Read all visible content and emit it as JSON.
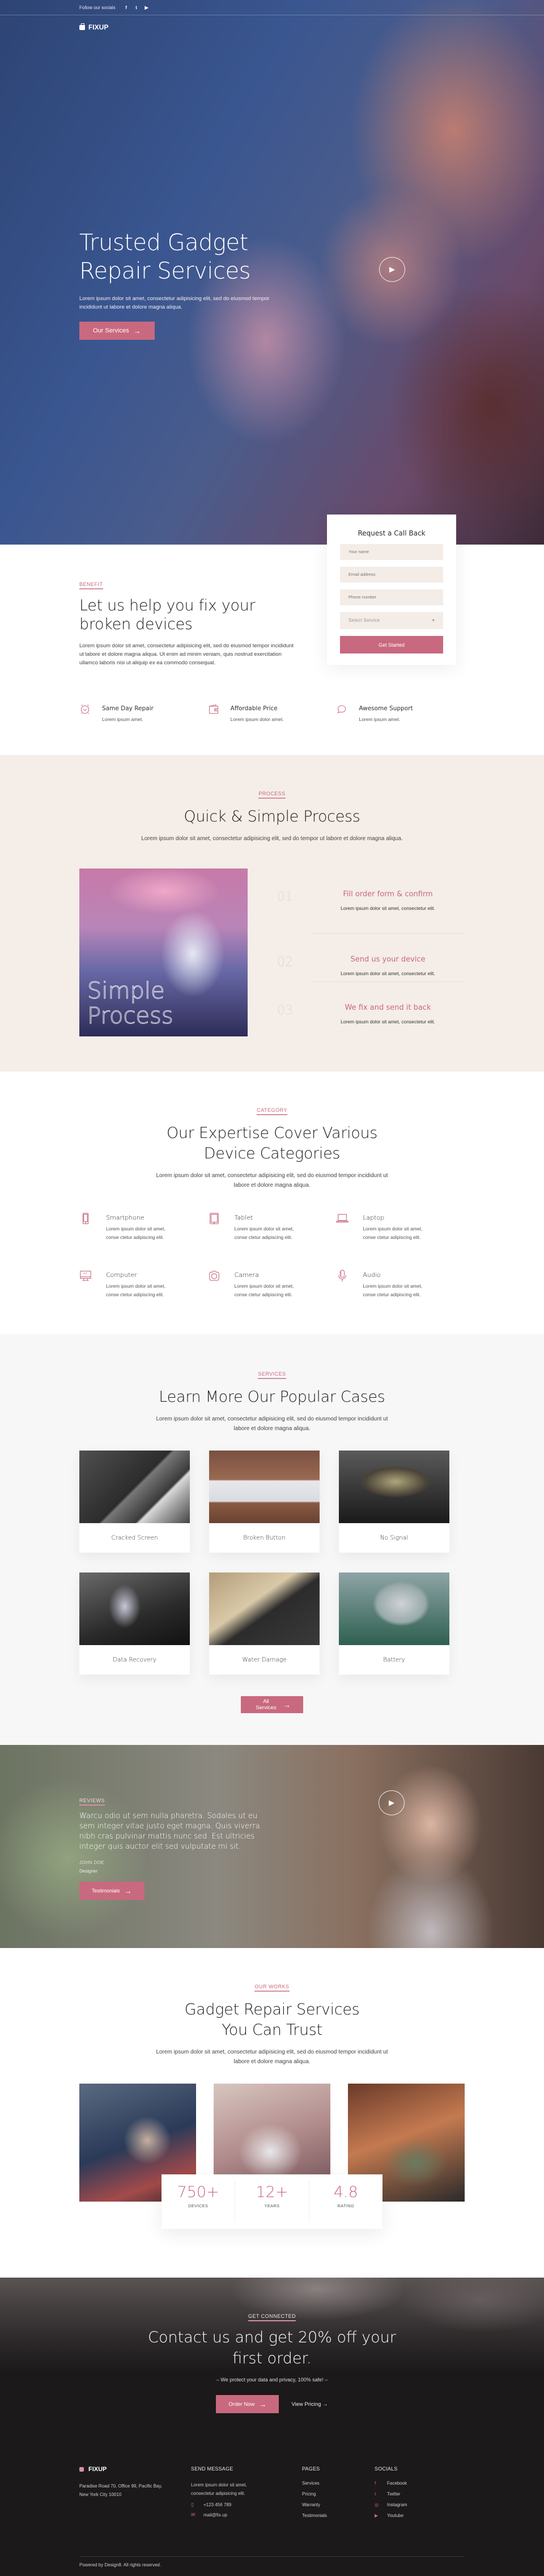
{
  "topbar": {
    "follow_label": "Follow our socials",
    "social_icons": [
      "facebook-icon",
      "twitter-icon",
      "youtube-icon"
    ]
  },
  "brand": {
    "name": "FIXUP",
    "accent_color": "#c9697f"
  },
  "hero": {
    "title": "Trusted Gadget Repair Services",
    "description": "Lorem ipsum dolor sit amet, consectetur adipisicing elit, sed do eiusmod tempor incididunt ut labore et dolore magna aliqua.",
    "button": "Our Services",
    "play_icon": "play-icon"
  },
  "callback": {
    "title": "Request a Call Back",
    "name_placeholder": "Your name",
    "email_placeholder": "Email address",
    "phone_placeholder": "Phone number",
    "service_selected": "Select Service",
    "submit": "Get Started"
  },
  "benefit": {
    "tag": "BENEFIT",
    "title": "Let us help you fix your broken devices",
    "text": "Lorem ipsum dolor sit amet, consectetur adipisicing elit, sed do eiusmod tempor incididunt ut labore et dolore magna aliqua. Ut enim ad minim veniam, quis nostrud exercitation ullamco laboris nisi ut aliquip ex ea commodo consequat.",
    "features": [
      {
        "icon": "alarm-clock-icon",
        "title": "Same Day Repair",
        "text": "Lorem ipsum amet."
      },
      {
        "icon": "wallet-icon",
        "title": "Affordable Price",
        "text": "Lorem ipsum dolor amet."
      },
      {
        "icon": "chat-bubble-icon",
        "title": "Awesome Support",
        "text": "Lorem ipsum amet."
      }
    ]
  },
  "process": {
    "tag": "PROCESS",
    "title": "Quick & Simple Process",
    "subtitle": "Lorem ipsum dolor sit amet, consectetur adipisicing elit, sed do  tempor  ut labore et dolore magna aliqua.",
    "image_label": "Simple Process",
    "steps": [
      {
        "num": "01",
        "title": "Fill order form & confirm",
        "text": "Lorem ipsum dolor sit amet, consectetur elit."
      },
      {
        "num": "02",
        "title": "Send us your device",
        "text": "Lorem ipsum dolor sit amet, consectetur elit."
      },
      {
        "num": "03",
        "title": "We fix and send it back",
        "text": "Lorem ipsum dolor sit amet, consectetur elit."
      }
    ]
  },
  "categories": {
    "tag": "CATEGORY",
    "title": "Our Expertise Cover Various Device Categories",
    "subtitle": "Lorem ipsum dolor sit amet, consectetur adipisicing elit, sed do eiusmod tempor incididunt ut labore et dolore magna aliqua.",
    "items": [
      {
        "icon": "smartphone-icon",
        "title": "Smartphone",
        "text": "Lorem ipsum dolor sit amet, conse ctetur adipiscing elit."
      },
      {
        "icon": "tablet-icon",
        "title": "Tablet",
        "text": "Lorem ipsum dolor sit amet, conse ctetur adipiscing elit."
      },
      {
        "icon": "laptop-icon",
        "title": "Laptop",
        "text": "Lorem ipsum dolor sit amet, conse ctetur adipiscing elit."
      },
      {
        "icon": "computer-icon",
        "title": "Computer",
        "text": "Lorem ipsum dolor sit amet, conse ctetur adipiscing elit."
      },
      {
        "icon": "camera-icon",
        "title": "Camera",
        "text": "Lorem ipsum dolor sit amet, conse ctetur adipiscing elit."
      },
      {
        "icon": "microphone-icon",
        "title": "Audio",
        "text": "Lorem ipsum dolor sit amet, conse ctetur adipiscing elit."
      }
    ]
  },
  "cases": {
    "tag": "SERVICES",
    "title": "Learn More Our Popular Cases",
    "subtitle": "Lorem ipsum dolor sit amet, consectetur adipisicing elit, sed do eiusmod tempor incididunt ut labore et dolore magna aliqua.",
    "items": [
      "Cracked Screen",
      "Broken Button",
      "No Signal",
      "Data Recovery",
      "Water Damage",
      "Battery"
    ],
    "button": "All Services"
  },
  "reviews": {
    "tag": "REVIEWS",
    "quote": "Warcu odio ut sem nulla pharetra. Sodales ut eu sem integer vitae justo eget magna. Quis viverra nibh cras pulvinar mattis nunc sed. Est ultricies integer quis auctor elit sed vulputate mi sit.",
    "name": "JOHN DOE",
    "role": "Designer",
    "button": "Testimonials"
  },
  "works": {
    "tag": "OUR WORKS",
    "title": "Gadget Repair Services You Can Trust",
    "subtitle": "Lorem ipsum dolor sit amet, consectetur adipisicing elit, sed do eiusmod tempor incididunt ut labore et dolore magna aliqua.",
    "stats": [
      {
        "value": "750+",
        "label": "DEVICES"
      },
      {
        "value": "12+",
        "label": "YEARS"
      },
      {
        "value": "4.8",
        "label": "RATING"
      }
    ]
  },
  "cta": {
    "tag": "GET CONNECTED",
    "title": "Contact us and get 20% off your first order.",
    "note": "– We protect your data and privacy, 100% safe! –",
    "primary": "Order Now",
    "secondary": "View Pricing"
  },
  "footer": {
    "address": "Paradise Road 70, Office 99, Pacific Bay,  New York City 10010",
    "send_heading": "SEND MESSAGE",
    "send_text": "Lorem ipsum dolor sit amet, consectetur adipisicing elit.",
    "phone": "+123 456 789",
    "email": "mail@fix.up",
    "pages_heading": "PAGES",
    "pages": [
      "Services",
      "Pricing",
      "Warranty",
      "Testimonials"
    ],
    "socials_heading": "SOCIALS",
    "socials": [
      "Facebook",
      "Twitter",
      "Instagram",
      "Youtube"
    ],
    "copyright": "Powered by Design8. All rights reserved."
  }
}
